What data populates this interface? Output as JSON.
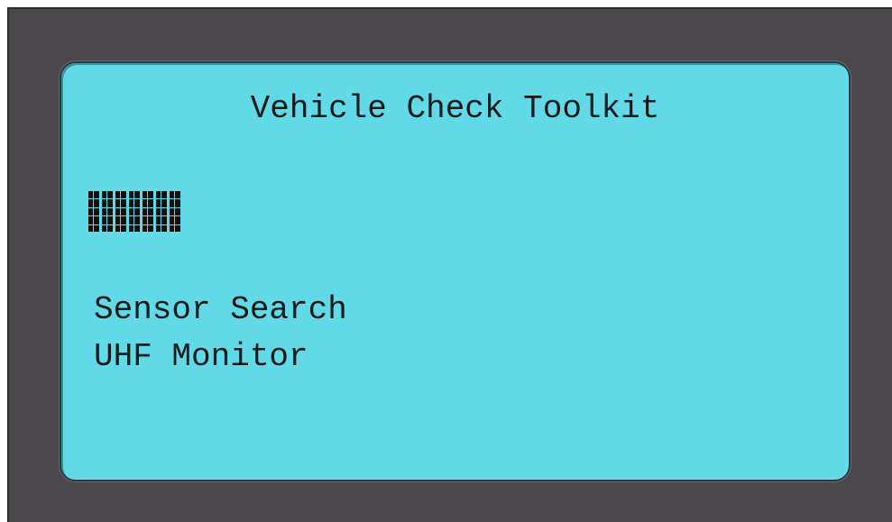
{
  "screen": {
    "title": "Vehicle Check Toolkit",
    "busy_indicator_icon": "progress-blocks-icon",
    "menu": {
      "items": [
        {
          "label": "Sensor Search"
        },
        {
          "label": "UHF Monitor"
        }
      ]
    }
  },
  "colors": {
    "frame": "#4a484b",
    "lcd_background": "#62d9e6",
    "lcd_text": "#1a1a1a"
  }
}
